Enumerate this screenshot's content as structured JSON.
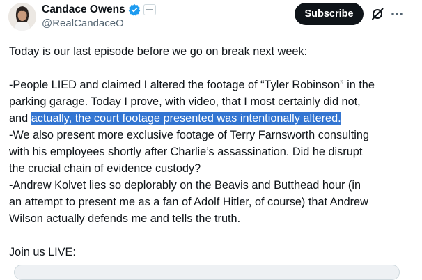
{
  "author": {
    "display_name": "Candace Owens",
    "handle": "@RealCandaceO"
  },
  "header": {
    "subscribe_label": "Subscribe",
    "grok_icon": "grok-slash-icon",
    "more_icon": "more-dots-icon"
  },
  "post": {
    "line1": "Today is our last episode before we go on break  next week:",
    "line2": "-People LIED and claimed I altered the footage of “Tyler Robinson” in the",
    "line3": "parking garage. Today I prove, with video, that I most certainly did not,",
    "line4_plain": "and ",
    "line4_highlight": "actually, the court footage presented was intentionally altered.",
    "line5": "-We also present more exclusive footage of Terry Farnsworth consulting",
    "line6": "with his employees shortly after Charlie’s assassination. Did he disrupt",
    "line7": "the crucial chain of evidence custody?",
    "line8": "-Andrew Kolvet lies so deplorably on the Beavis and Butthead hour (in",
    "line9": "an attempt to present me as a fan of Adolf Hitler, of course) that Andrew",
    "line10": "Wilson actually defends me and tells the truth.",
    "line11": "Join us LIVE:"
  },
  "colors": {
    "verified_badge": "#1d9bf0",
    "selection_highlight": "#3476d2",
    "subscribe_bg": "#0f1419"
  }
}
